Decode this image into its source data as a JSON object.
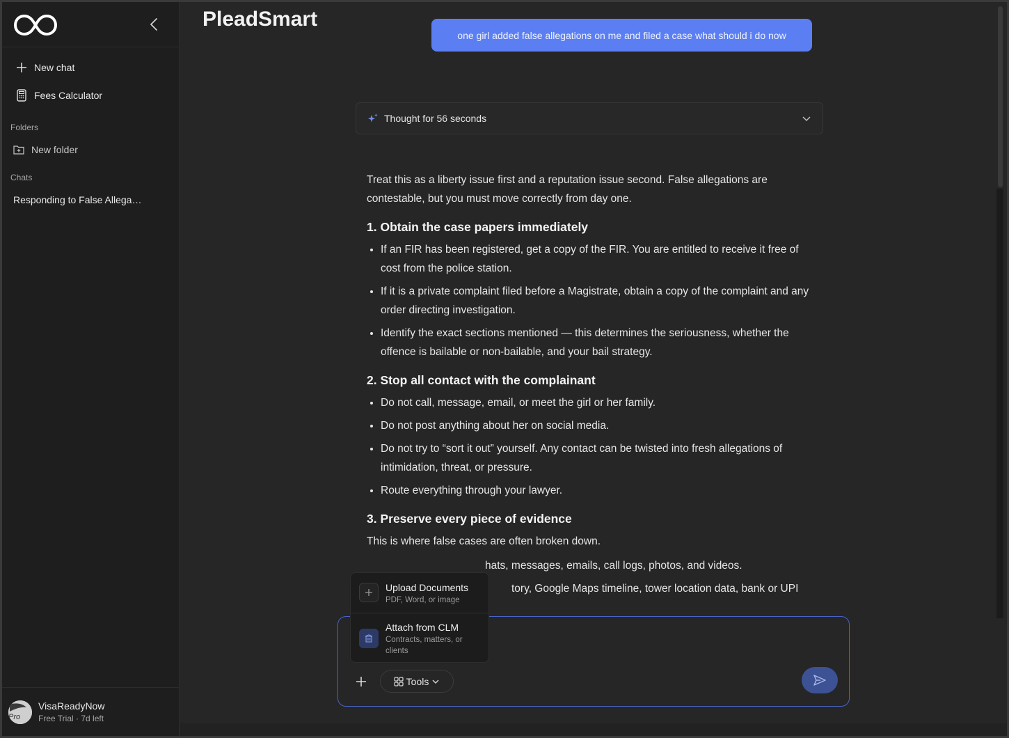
{
  "app": {
    "title": "PleadSmart"
  },
  "sidebar": {
    "new_chat": "New chat",
    "fees_calculator": "Fees Calculator",
    "folders_header": "Folders",
    "new_folder": "New folder",
    "chats_header": "Chats",
    "chats": [
      "Responding to False Allega…"
    ]
  },
  "user": {
    "name": "VisaReadyNow",
    "plan": "Free Trial · 7d left",
    "avatar_text": "Pro"
  },
  "conversation": {
    "user_message": "one girl added false allegations on me and filed a case what should i do now",
    "thought_label": "Thought for 56 seconds",
    "intro": "Treat this as a liberty issue first and a reputation issue second. False allegations are contestable, but you must move correctly from day one.",
    "section1_title": "1. Obtain the case papers immediately",
    "section1_items": [
      "If an FIR has been registered, get a copy of the FIR. You are entitled to receive it free of cost from the police station.",
      "If it is a private complaint filed before a Magistrate, obtain a copy of the complaint and any order directing investigation.",
      "Identify the exact sections mentioned — this determines the seriousness, whether the offence is bailable or non-bailable, and your bail strategy."
    ],
    "section2_title": "2. Stop all contact with the complainant",
    "section2_items": [
      "Do not call, message, email, or meet the girl or her family.",
      "Do not post anything about her on social media.",
      "Do not try to “sort it out” yourself. Any contact can be twisted into fresh allegations of intimidation, threat, or pressure.",
      "Route everything through your lawyer."
    ],
    "section3_title": "3. Preserve every piece of evidence",
    "section3_intro": "This is where false cases are often broken down.",
    "section3_items": [
      "hats, messages, emails, call logs, photos, and videos.",
      "tory, Google Maps timeline, tower location data, bank or UPI"
    ]
  },
  "popup": {
    "upload_title": "Upload Documents",
    "upload_sub": "PDF, Word, or image",
    "clm_title": "Attach from CLM",
    "clm_sub": "Contracts, matters, or clients"
  },
  "composer": {
    "tools_label": "Tools"
  },
  "colors": {
    "accent": "#5b7ff2",
    "send": "#3c5294",
    "background": "#262626",
    "sidebar": "#1e1e1e"
  }
}
